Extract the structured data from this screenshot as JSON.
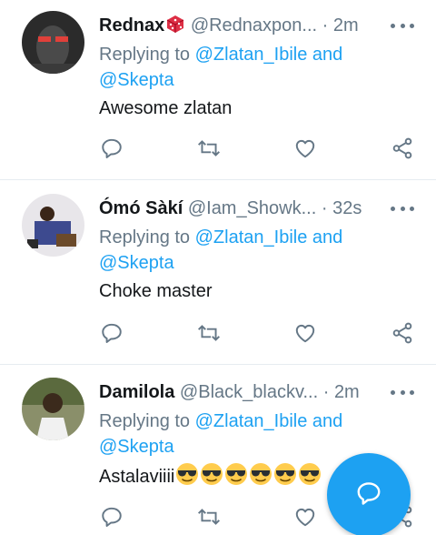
{
  "tweets": [
    {
      "display_name": "Rednax",
      "name_emoji": "game-die-emoji",
      "handle": "@Rednaxpon...",
      "separator": "·",
      "time": "2m",
      "replying_prefix": "Replying to",
      "mention_1": "@Zlatan_Ibile and",
      "mention_2": "@Skepta",
      "text": "Awesome zlatan"
    },
    {
      "display_name": "Ómó Sàkí",
      "handle": "@Iam_Showk...",
      "separator": "·",
      "time": "32s",
      "replying_prefix": "Replying to",
      "mention_1": "@Zlatan_Ibile and",
      "mention_2": "@Skepta",
      "text": "Choke master"
    },
    {
      "display_name": "Damilola",
      "handle": "@Black_blackv...",
      "separator": "·",
      "time": "2m",
      "replying_prefix": "Replying to",
      "mention_1": "@Zlatan_Ibile and",
      "mention_2": "@Skepta",
      "text": "Astalaviiii",
      "trailing_emoji": "smiling-face-with-sunglasses-emoji",
      "trailing_emoji_count": 6
    }
  ],
  "icons": {
    "reply": "reply-icon",
    "retweet": "retweet-icon",
    "like": "like-icon",
    "share": "share-icon",
    "more": "more-icon",
    "compose": "compose-reply-icon"
  },
  "colors": {
    "accent": "#1da1f2",
    "secondary_text": "#657786",
    "primary_text": "#14171a",
    "divider": "#e6ecf0"
  }
}
